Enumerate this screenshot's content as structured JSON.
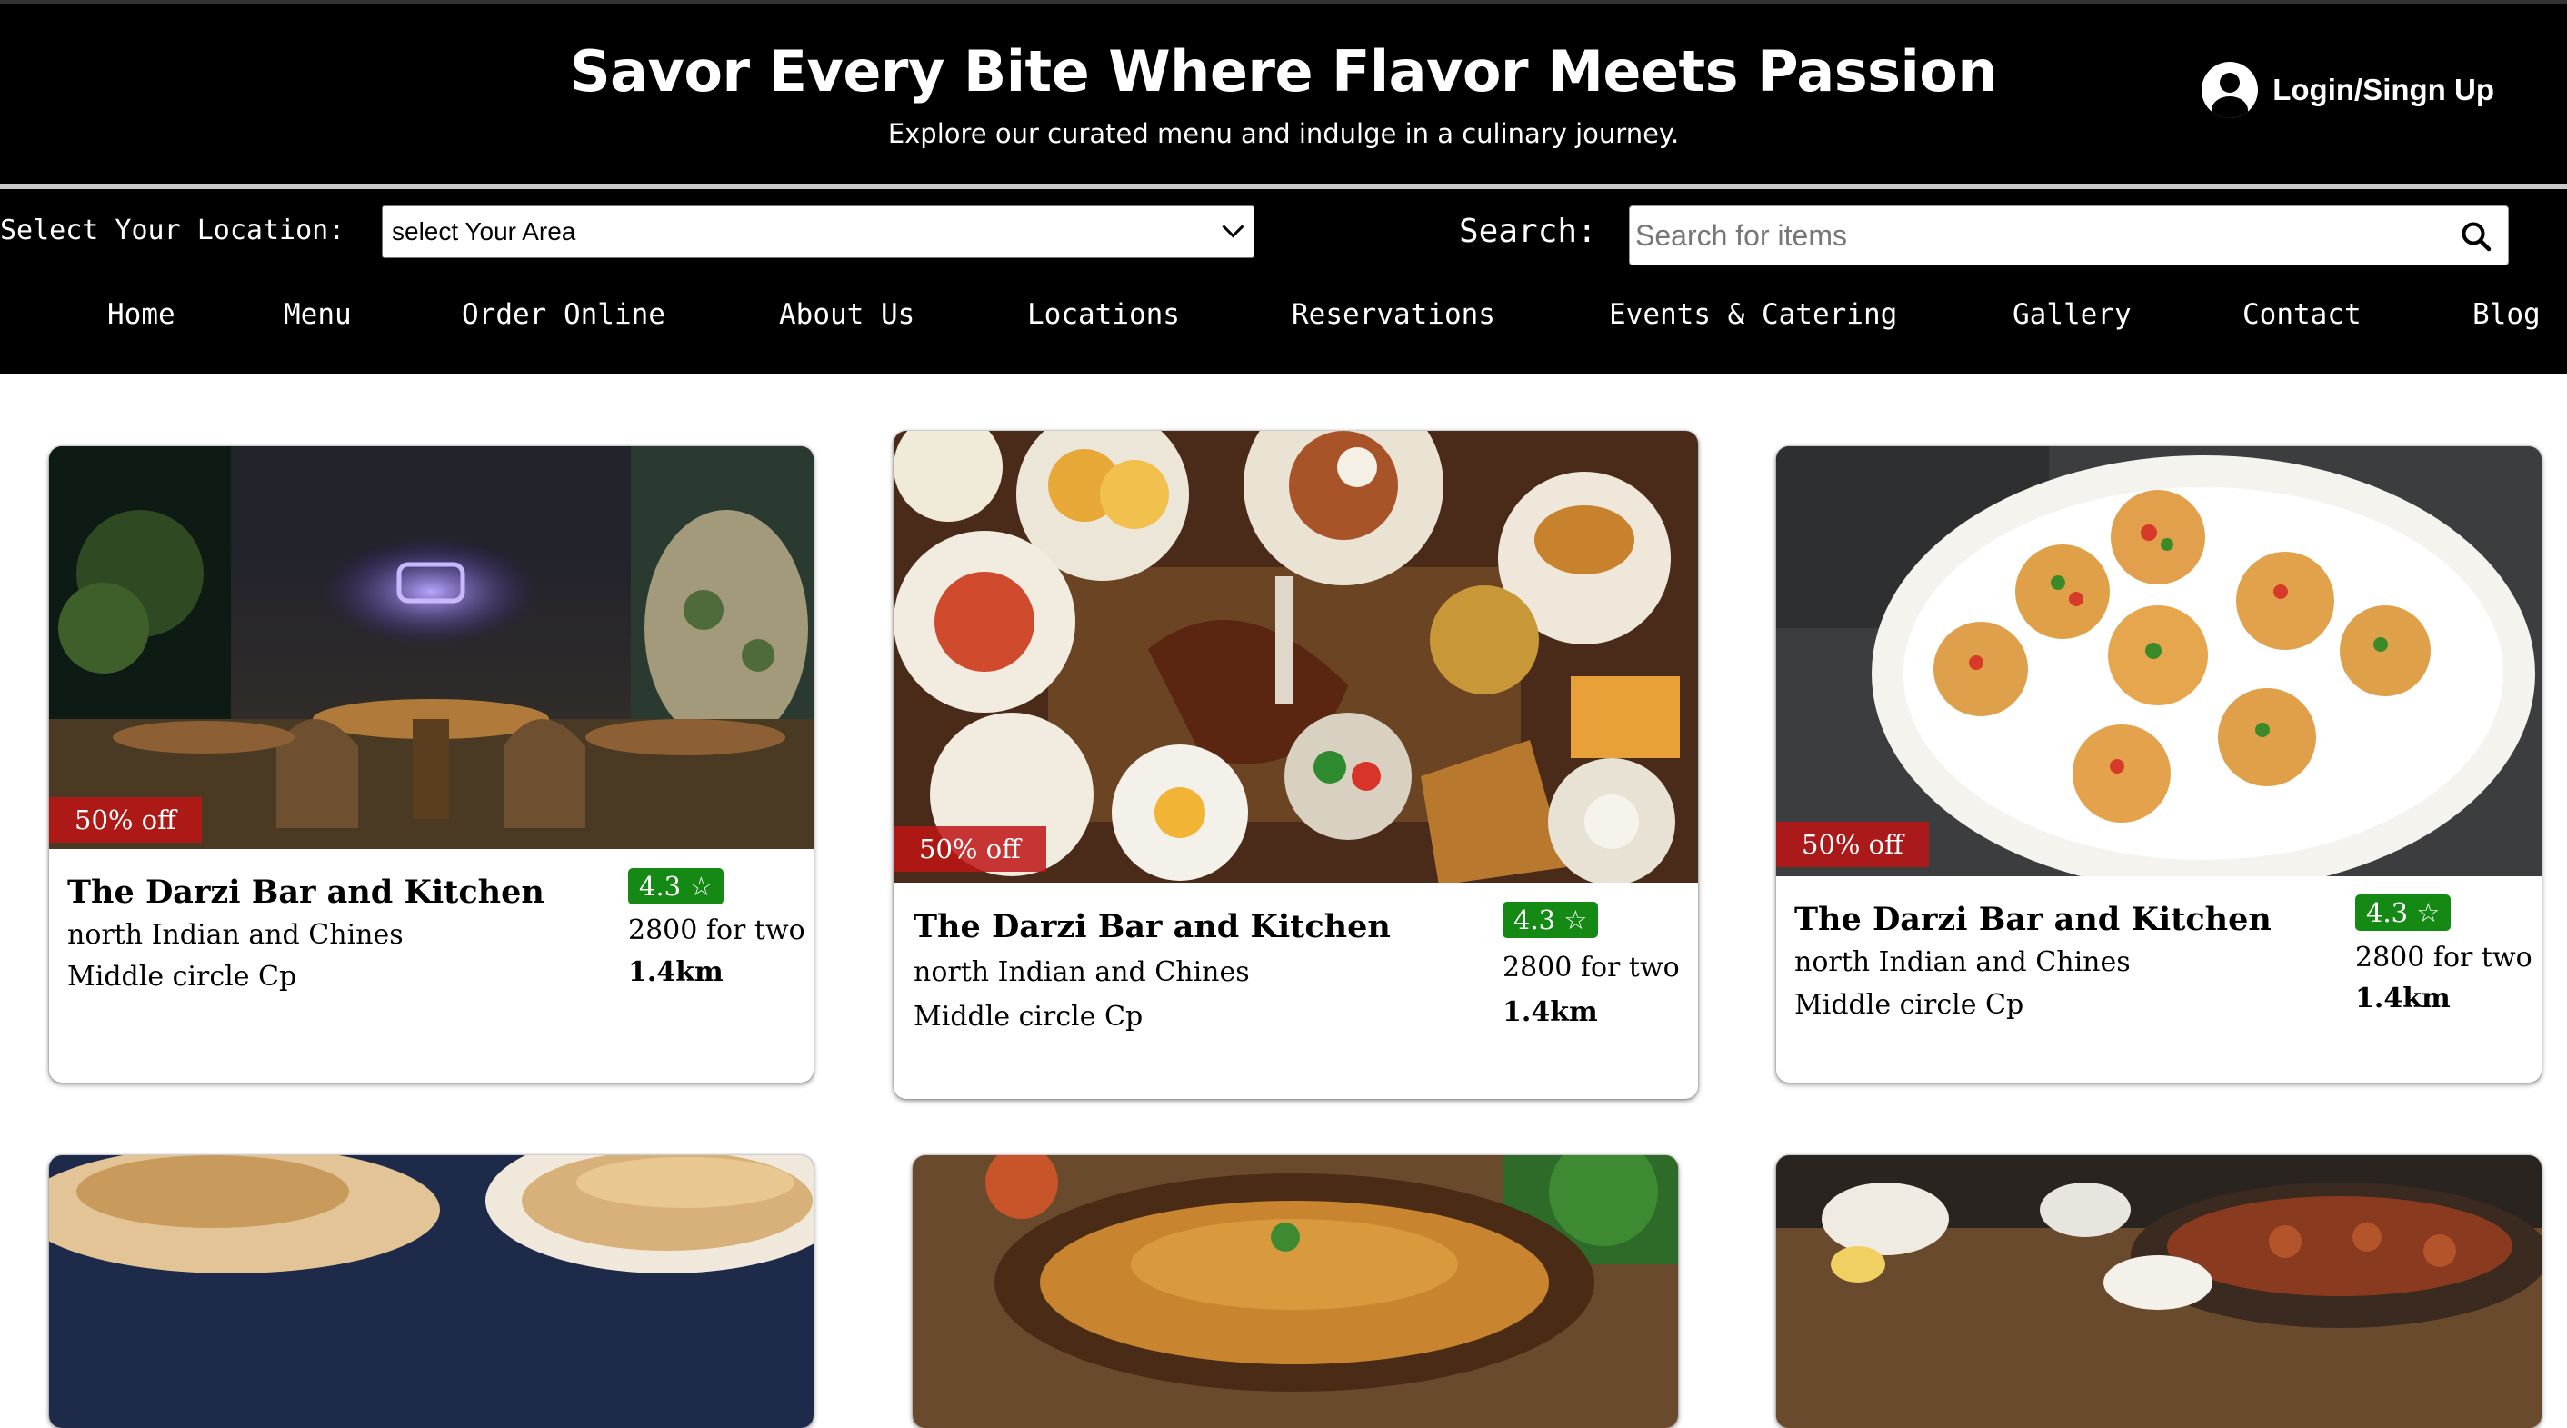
{
  "header": {
    "title": "Savor Every Bite Where Flavor Meets Passion",
    "subtitle": "Explore our curated menu and indulge in a culinary journey.",
    "login_label": "Login/Singn Up"
  },
  "filters": {
    "location_label": "Select Your Location:",
    "location_value": "select Your Area",
    "search_label": "Search:",
    "search_placeholder": "Search for items"
  },
  "nav": {
    "items": [
      "Home",
      "Menu",
      "Order Online",
      "About Us",
      "Locations",
      "Reservations",
      "Events & Catering",
      "Gallery",
      "Contact",
      "Blog"
    ]
  },
  "restaurants": [
    {
      "discount": "50% off",
      "name": "The Darzi Bar and Kitchen",
      "cuisine": "north Indian and Chines",
      "area": "Middle circle Cp",
      "rating": "4.3 ☆",
      "price": "2800 for two",
      "distance": "1.4km"
    },
    {
      "discount": "50% off",
      "name": "The Darzi Bar and Kitchen",
      "cuisine": "north Indian and Chines",
      "area": "Middle circle Cp",
      "rating": "4.3 ☆",
      "price": "2800 for two",
      "distance": "1.4km"
    },
    {
      "discount": "50% off",
      "name": "The Darzi Bar and Kitchen",
      "cuisine": "north Indian and Chines",
      "area": "Middle circle Cp",
      "rating": "4.3 ☆",
      "price": "2800 for two",
      "distance": "1.4km"
    }
  ],
  "colors": {
    "header_bg": "#000000",
    "discount_bg": "#be1414",
    "rating_bg": "#148a14"
  }
}
